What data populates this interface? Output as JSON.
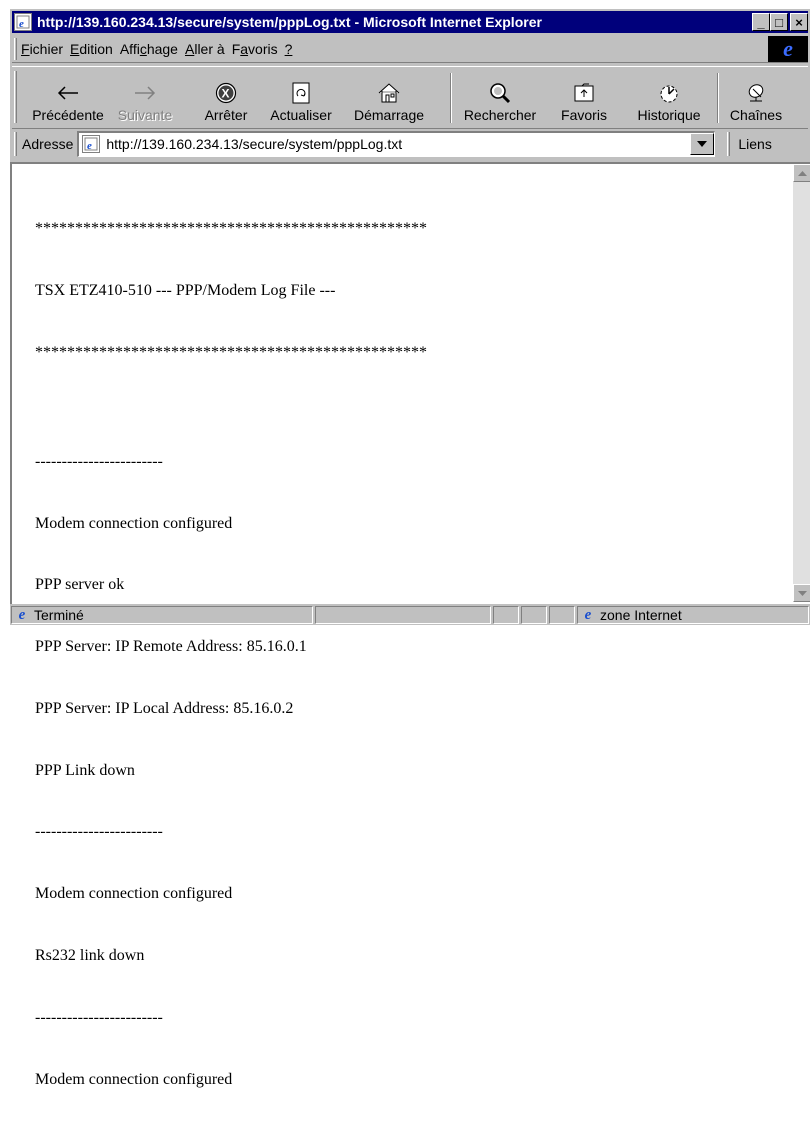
{
  "window": {
    "title": "http://139.160.234.13/secure/system/pppLog.txt - Microsoft Internet Explorer",
    "controls": {
      "minimize": "_",
      "maximize": "□",
      "close": "×"
    }
  },
  "menu": {
    "items": [
      {
        "pre": "",
        "u": "F",
        "post": "ichier"
      },
      {
        "pre": "",
        "u": "E",
        "post": "dition"
      },
      {
        "pre": "Affi",
        "u": "c",
        "post": "hage"
      },
      {
        "pre": "",
        "u": "A",
        "post": "ller à"
      },
      {
        "pre": "F",
        "u": "a",
        "post": "voris"
      },
      {
        "pre": "",
        "u": "?",
        "post": ""
      }
    ],
    "logo": "e"
  },
  "toolbar": {
    "back": "Précédente",
    "forward": "Suivante",
    "stop": "Arrêter",
    "refresh": "Actualiser",
    "home": "Démarrage",
    "search": "Rechercher",
    "favorites": "Favoris",
    "history": "Historique",
    "channels": "Chaînes"
  },
  "address": {
    "label": "Adresse",
    "url": "http://139.160.234.13/secure/system/pppLog.txt",
    "links": "Liens"
  },
  "document": {
    "lines": [
      "*************************************************",
      "TSX ETZ410-510 --- PPP/Modem Log File ---",
      "*************************************************",
      "",
      "------------------------",
      "Modem connection configured",
      "PPP server ok",
      "PPP Server: IP Remote Address: 85.16.0.1",
      "PPP Server: IP Local Address: 85.16.0.2",
      "PPP Link down",
      "------------------------",
      "Modem connection configured",
      "Rs232 link down",
      "------------------------",
      "Modem connection configured"
    ]
  },
  "status": {
    "text": "Terminé",
    "zone": "zone Internet"
  },
  "icons": {
    "back": "arrow-left-icon",
    "forward": "arrow-right-icon",
    "stop": "stop-icon",
    "refresh": "refresh-icon",
    "home": "home-icon",
    "search": "search-icon",
    "favorites": "favorites-icon",
    "history": "history-icon",
    "channels": "satellite-dish-icon"
  },
  "colors": {
    "titlebar": "#00007b",
    "chrome": "#c0c0c0",
    "ie_blue": "#3b6cff"
  }
}
